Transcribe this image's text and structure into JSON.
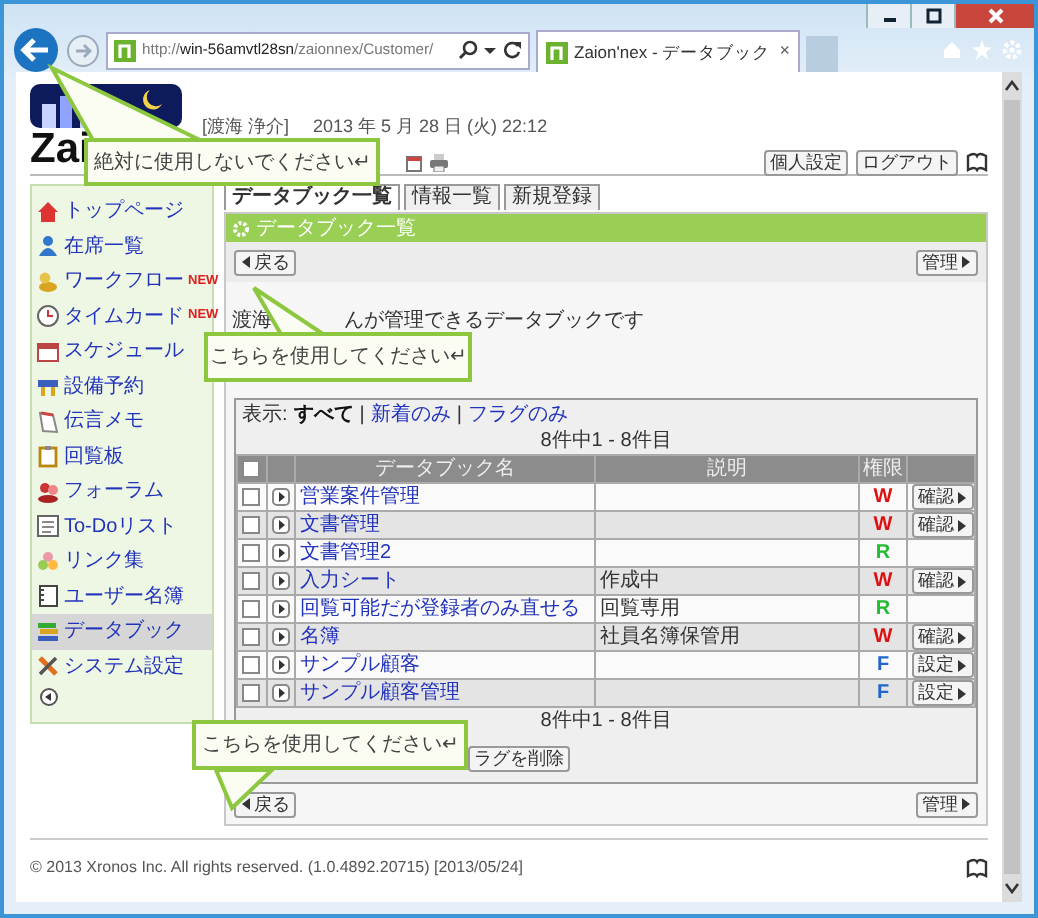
{
  "browser": {
    "address": "http://**win-56amvtl28sn**/zaionnex/Customer/",
    "tab_title": "Zaion'nex - データブック",
    "tab_close": "×"
  },
  "header": {
    "logo_text": "Zai",
    "user": "[渡海 浄介]",
    "datetime": "2013 年 5 月 28 日 (火) 22:12",
    "buttons": [
      "個人設定",
      "ログアウト"
    ]
  },
  "sidebar": {
    "items": [
      {
        "label": "トップページ",
        "selected": false
      },
      {
        "label": "在席一覧",
        "selected": false
      },
      {
        "label": "ワークフロー",
        "badge": "NEW",
        "selected": false
      },
      {
        "label": "タイムカード",
        "badge": "NEW",
        "selected": false
      },
      {
        "label": "スケジュール",
        "selected": false
      },
      {
        "label": "設備予約",
        "selected": false
      },
      {
        "label": "伝言メモ",
        "selected": false
      },
      {
        "label": "回覧板",
        "selected": false
      },
      {
        "label": "フォーラム",
        "selected": false
      },
      {
        "label": "To-Doリスト",
        "selected": false
      },
      {
        "label": "リンク集",
        "selected": false
      },
      {
        "label": "ユーザー名簿",
        "selected": false
      },
      {
        "label": "データブック",
        "selected": true
      },
      {
        "label": "システム設定",
        "selected": false
      }
    ]
  },
  "tabs": [
    {
      "label": "データブック一覧",
      "selected": true
    },
    {
      "label": "情報一覧",
      "selected": false
    },
    {
      "label": "新規登録",
      "selected": false
    }
  ],
  "panel_title": "データブック一覧",
  "toolbar_top": {
    "back": "戻る",
    "manage": "管理"
  },
  "intro": {
    "before": "渡海",
    "after": "んが管理できるデータブックです"
  },
  "filter": {
    "label": "表示:",
    "separator": "|",
    "options": [
      {
        "label": "すべて",
        "selected": true
      },
      {
        "label": "新着のみ",
        "selected": false
      },
      {
        "label": "フラグのみ",
        "selected": false
      }
    ]
  },
  "count_top": "8件中1 - 8件目",
  "select_all_checked": false,
  "columns": [
    "データブック名",
    "説明",
    "権限"
  ],
  "rows": [
    {
      "checked": false,
      "name": "営業案件管理",
      "permission": "W",
      "color": "#dd1111",
      "action": "確認"
    },
    {
      "checked": false,
      "name": "文書管理",
      "permission": "W",
      "color": "#dd1111",
      "action": "確認"
    },
    {
      "checked": false,
      "name": "文書管理2",
      "permission": "R",
      "color": "#22bb33"
    },
    {
      "checked": false,
      "name": "入力シート",
      "description": "作成中",
      "permission": "W",
      "color": "#dd1111",
      "action": "確認"
    },
    {
      "checked": false,
      "name": "回覧可能だが登録者のみ直せる",
      "description": "回覧専用",
      "permission": "R",
      "color": "#22bb33"
    },
    {
      "checked": false,
      "name": "名簿",
      "description": "社員名簿保管用",
      "permission": "W",
      "color": "#dd1111",
      "action": "確認"
    },
    {
      "checked": false,
      "name": "サンプル顧客",
      "permission": "F",
      "color": "#2266cc",
      "action": "設定"
    },
    {
      "checked": false,
      "name": "サンプル顧客管理",
      "permission": "F",
      "color": "#2266cc",
      "action": "設定"
    }
  ],
  "count_bottom": "8件中1 - 8件目",
  "bulk_button": "ラグを削除",
  "toolbar_bottom": {
    "back": "戻る",
    "manage": "管理"
  },
  "footer": {
    "copyright": "© 2013 Xronos Inc. All rights reserved. (1.0.4892.20715) [2013/05/24]"
  },
  "callouts": [
    {
      "text": "絶対に使用しないでください↵"
    },
    {
      "text": "こちらを使用してください↵"
    },
    {
      "text": "こちらを使用してください↵"
    }
  ]
}
